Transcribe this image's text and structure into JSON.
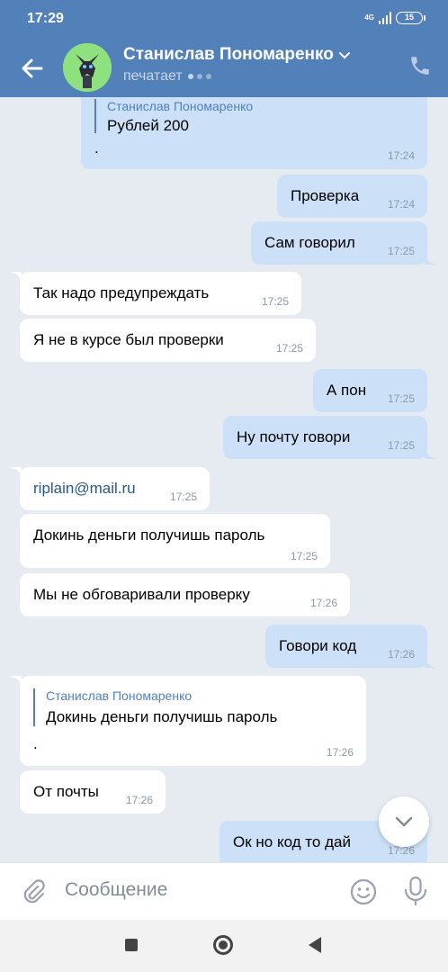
{
  "status": {
    "time": "17:29",
    "network": "4G",
    "battery": "15"
  },
  "header": {
    "name": "Станислав Пономаренко",
    "status": "печатает"
  },
  "messages": [
    {
      "dir": "out",
      "quote_name": "Станислав Пономаренко",
      "quote_text": "Рублей 200",
      "text": ".",
      "time": "17:24"
    },
    {
      "dir": "out",
      "text": "Проверка",
      "time": "17:24"
    },
    {
      "dir": "out",
      "text": "Сам говорил",
      "time": "17:25"
    },
    {
      "dir": "in",
      "text": "Так надо предупреждать",
      "time": "17:25"
    },
    {
      "dir": "in",
      "text": "Я не в курсе был проверки",
      "time": "17:25"
    },
    {
      "dir": "out",
      "text": "А пон",
      "time": "17:25"
    },
    {
      "dir": "out",
      "text": "Ну почту говори",
      "time": "17:25"
    },
    {
      "dir": "in",
      "text": "riplain@mail.ru",
      "time": "17:25",
      "link": true
    },
    {
      "dir": "in",
      "text": "Докинь деньги получишь пароль",
      "time": "17:25"
    },
    {
      "dir": "in",
      "text": "Мы не обговаривали проверку",
      "time": "17:26"
    },
    {
      "dir": "out",
      "text": "Говори код",
      "time": "17:26"
    },
    {
      "dir": "in",
      "quote_name": "Станислав Пономаренко",
      "quote_text": "Докинь деньги получишь пароль",
      "text": ".",
      "time": "17:26"
    },
    {
      "dir": "in",
      "text": "От почты",
      "time": "17:26"
    },
    {
      "dir": "out",
      "text": "Ок но код то дай",
      "time": "17:26"
    }
  ],
  "input": {
    "placeholder": "Сообщение"
  },
  "colors": {
    "accent": "#5181b8",
    "outgoing": "#cce0f8",
    "incoming": "#ffffff",
    "background": "#e5ebf1"
  },
  "icons": [
    "back-arrow-icon",
    "chevron-down-icon",
    "phone-icon",
    "paperclip-icon",
    "smile-icon",
    "microphone-icon",
    "chevron-down-icon"
  ]
}
